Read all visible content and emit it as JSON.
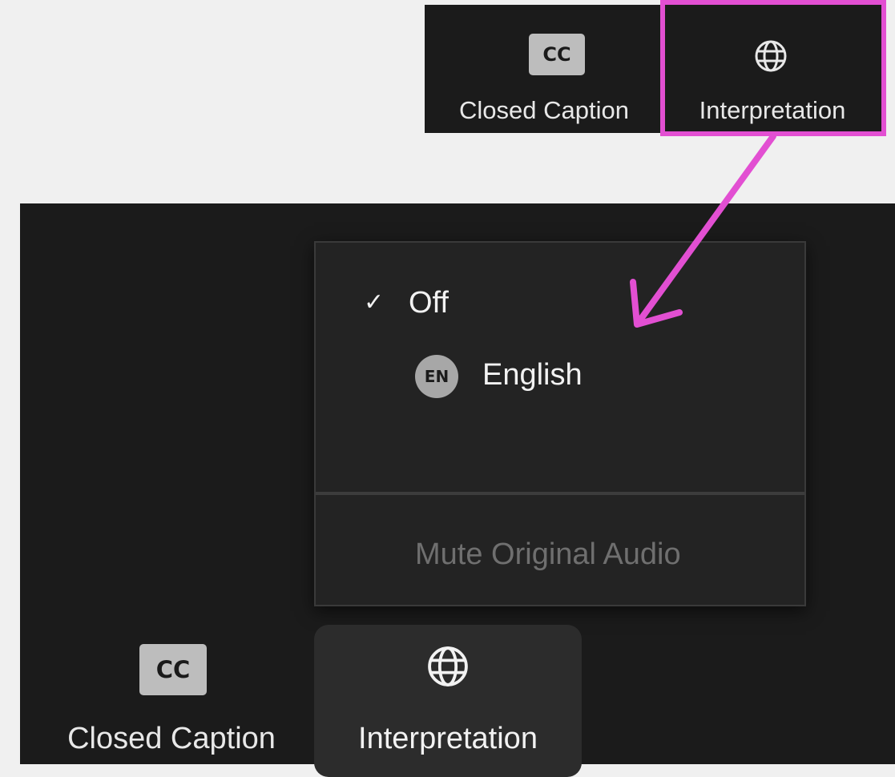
{
  "top_toolbar": {
    "closed_caption": {
      "badge": "CC",
      "label": "Closed Caption"
    },
    "interpretation": {
      "label": "Interpretation"
    }
  },
  "interpretation_menu": {
    "items": [
      {
        "label": "Off",
        "checked": true,
        "check_glyph": "✓"
      },
      {
        "label": "English",
        "badge": "EN",
        "checked": false
      }
    ],
    "mute_label": "Mute Original Audio"
  },
  "bottom_toolbar": {
    "closed_caption": {
      "badge": "CC",
      "label": "Closed Caption"
    },
    "interpretation": {
      "label": "Interpretation",
      "active": true
    }
  },
  "annotation": {
    "highlight_color": "#e24fd2",
    "arrow_color": "#e24fd2"
  },
  "colors": {
    "toolbar_bg": "#1b1b1b",
    "menu_bg": "#232323",
    "page_bg": "#f0f0f0",
    "disabled_text": "#6f6f6f"
  },
  "icons": {
    "globe": "globe-icon",
    "check": "checkmark-icon",
    "cc": "closed-caption-icon"
  }
}
